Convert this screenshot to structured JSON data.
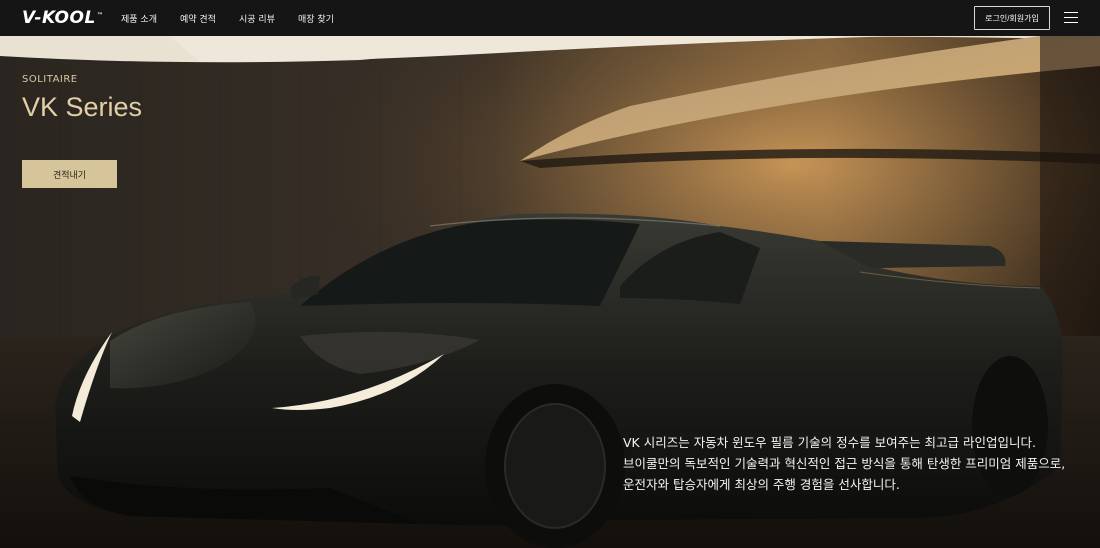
{
  "header": {
    "logo": "V-KOOL",
    "logo_mark": "™",
    "nav": [
      {
        "label": "제품 소개"
      },
      {
        "label": "예약 견적"
      },
      {
        "label": "시공 리뷰"
      },
      {
        "label": "매장 찾기"
      }
    ],
    "login_label": "로그인/회원가입",
    "menu_icon": "hamburger-icon"
  },
  "hero": {
    "eyebrow": "SOLITAIRE",
    "title": "VK Series",
    "cta_label": "견적내기",
    "description": [
      "VK 시리즈는 자동차 윈도우 필름 기술의 정수를 보여주는 최고급 라인업입니다.",
      "브이쿨만의 독보적인 기술력과 혁신적인 접근 방식을 통해 탄생한 프리미엄 제품으로,",
      "운전자와 탑승자에게 최상의 주행 경험을 선사합니다."
    ],
    "image": "black-sports-car-photo"
  },
  "colors": {
    "accent_gold": "#d6c49a",
    "title_gold": "#e3cfa5",
    "header_bg": "#151515"
  }
}
